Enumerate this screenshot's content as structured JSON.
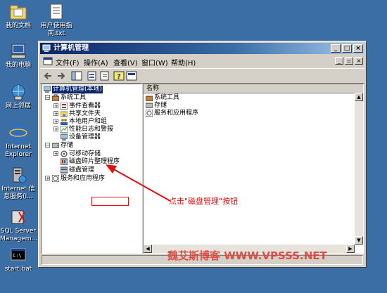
{
  "desktop": {
    "icons": [
      {
        "label": "我的文档",
        "icon": "folder-documents-icon"
      },
      {
        "label": "用户使用指南.txt",
        "icon": "text-file-icon"
      },
      {
        "label": "我的电脑",
        "icon": "my-computer-icon"
      },
      {
        "label": "网上邻居",
        "icon": "network-places-icon"
      },
      {
        "label": "Internet Explorer",
        "icon": "internet-explorer-icon"
      },
      {
        "label": "Internet 信息服务(I...",
        "icon": "iis-manager-icon"
      },
      {
        "label": "SQL Server Managem...",
        "icon": "sql-server-icon"
      },
      {
        "label": "start.bat",
        "icon": "batch-file-icon"
      }
    ]
  },
  "window": {
    "title": "计算机管理",
    "menu": [
      "文件(F)",
      "操作(A)",
      "查看(V)",
      "窗口(W)",
      "帮助(H)"
    ]
  },
  "tree": {
    "root": "计算机管理(本地)",
    "system_tools": "系统工具",
    "event_viewer": "事件查看器",
    "shared_folders": "共享文件夹",
    "local_users": "本地用户和组",
    "perf_logs": "性能日志和警报",
    "device_manager": "设备管理器",
    "storage": "存储",
    "removable": "可移动存储",
    "defrag": "磁盘碎片整理程序",
    "disk_mgmt": "磁盘管理",
    "services": "服务和应用程序"
  },
  "list": {
    "header": "名称",
    "items": [
      "系统工具",
      "存储",
      "服务和应用程序"
    ]
  },
  "annotation": {
    "text": "点击\"磁盘管理\"按钮",
    "color": "#e01010"
  },
  "watermark": "魏艾斯博客 WWW.VPSSS.NET"
}
